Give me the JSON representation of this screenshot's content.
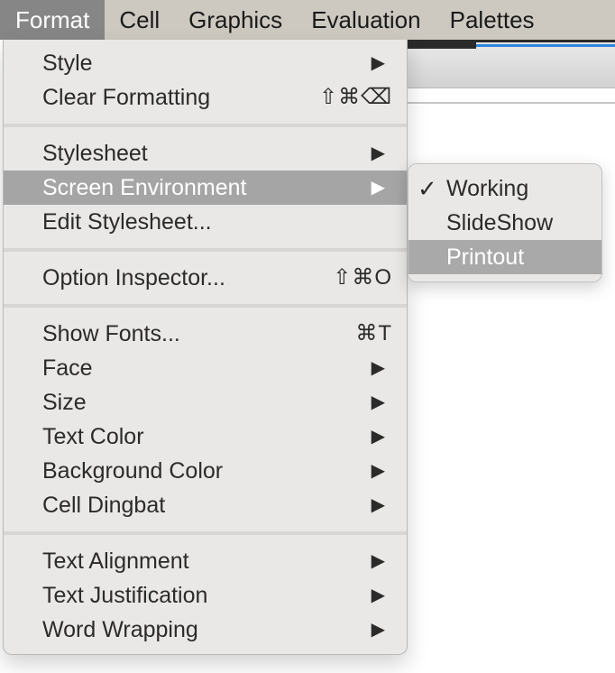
{
  "menubar": {
    "items": [
      {
        "label": "Format",
        "active": true
      },
      {
        "label": "Cell"
      },
      {
        "label": "Graphics"
      },
      {
        "label": "Evaluation"
      },
      {
        "label": "Palettes"
      }
    ]
  },
  "format_menu": {
    "items": [
      {
        "label": "Style",
        "submenu": true,
        "arrow": "▶"
      },
      {
        "label": "Clear Formatting",
        "shortcut": "⇧⌘⌫"
      },
      {
        "label": "Stylesheet",
        "submenu": true,
        "arrow": "▶"
      },
      {
        "label": "Screen Environment",
        "submenu": true,
        "arrow": "▶",
        "highlighted": true
      },
      {
        "label": "Edit Stylesheet..."
      },
      {
        "label": "Option Inspector...",
        "shortcut": "⇧⌘O"
      },
      {
        "label": "Show Fonts...",
        "shortcut": "⌘T"
      },
      {
        "label": "Face",
        "submenu": true,
        "arrow": "▶"
      },
      {
        "label": "Size",
        "submenu": true,
        "arrow": "▶"
      },
      {
        "label": "Text Color",
        "submenu": true,
        "arrow": "▶"
      },
      {
        "label": "Background Color",
        "submenu": true,
        "arrow": "▶"
      },
      {
        "label": "Cell Dingbat",
        "submenu": true,
        "arrow": "▶"
      },
      {
        "label": "Text Alignment",
        "submenu": true,
        "arrow": "▶"
      },
      {
        "label": "Text Justification",
        "submenu": true,
        "arrow": "▶"
      },
      {
        "label": "Word Wrapping",
        "submenu": true,
        "arrow": "▶"
      }
    ]
  },
  "screen_environment_submenu": {
    "items": [
      {
        "label": "Working",
        "checked": true,
        "check": "✓"
      },
      {
        "label": "SlideShow"
      },
      {
        "label": "Printout",
        "highlighted": true
      }
    ]
  },
  "colors": {
    "menubar_bg": "#cdc9c0",
    "menu_bg": "#e9e8e6",
    "highlight": "#a5a5a5",
    "accent_blue": "#2f86e0"
  }
}
